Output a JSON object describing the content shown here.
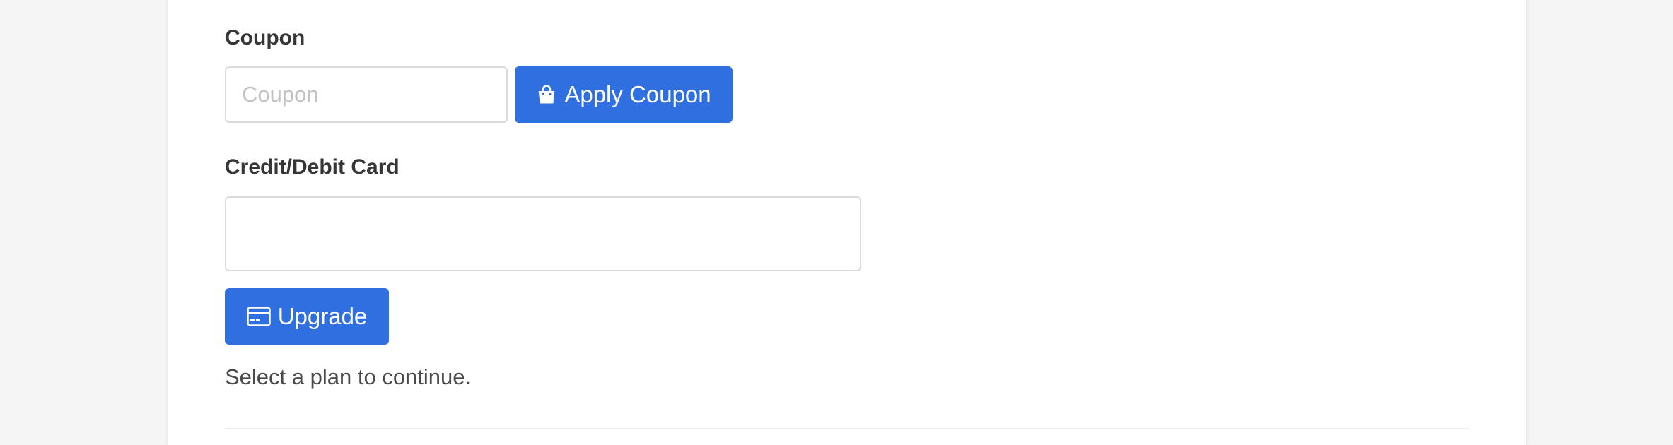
{
  "coupon": {
    "label": "Coupon",
    "placeholder": "Coupon",
    "value": "",
    "apply_label": "Apply Coupon",
    "apply_icon": "shopping-bag-icon"
  },
  "card": {
    "label": "Credit/Debit Card",
    "value": ""
  },
  "upgrade": {
    "label": "Upgrade",
    "icon": "credit-card-icon"
  },
  "hint": "Select a plan to continue.",
  "colors": {
    "primary": "#2f6fdf",
    "background": "#f5f5f5",
    "card": "#ffffff",
    "text": "#363636",
    "border": "#dbdbdb"
  }
}
